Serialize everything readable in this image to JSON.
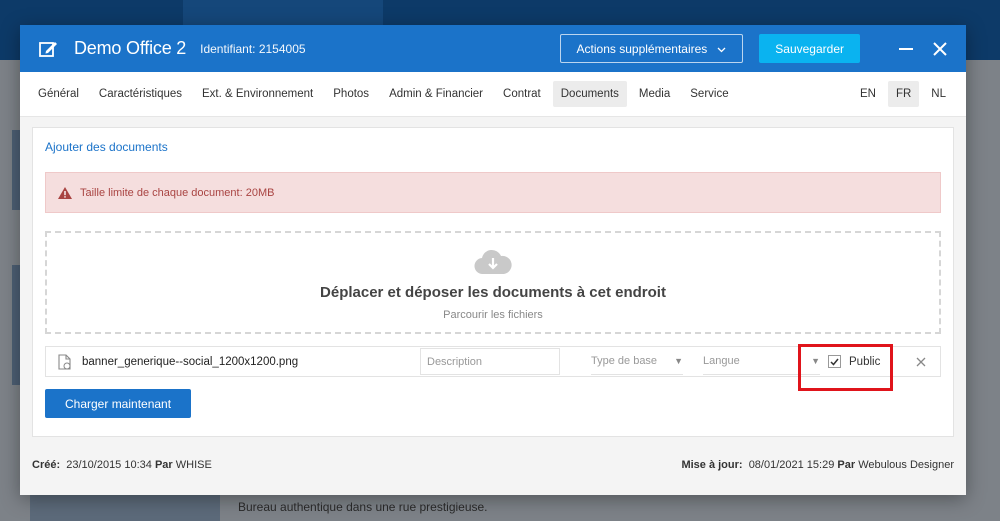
{
  "modal": {
    "title": "Demo Office 2",
    "identifier": "Identifiant: 2154005",
    "actions_label": "Actions supplémentaires",
    "save_label": "Sauvegarder"
  },
  "tabs": [
    {
      "label": "Général"
    },
    {
      "label": "Caractéristiques"
    },
    {
      "label": "Ext. & Environnement"
    },
    {
      "label": "Photos"
    },
    {
      "label": "Admin & Financier"
    },
    {
      "label": "Contrat"
    },
    {
      "label": "Documents",
      "active": true
    },
    {
      "label": "Media"
    },
    {
      "label": "Service"
    }
  ],
  "languages": [
    {
      "label": "EN"
    },
    {
      "label": "FR",
      "active": true
    },
    {
      "label": "NL"
    }
  ],
  "documents": {
    "section_title": "Ajouter des documents",
    "alert_text": "Taille limite de chaque document: 20MB",
    "dropzone_title": "Déplacer et déposer les documents à cet endroit",
    "dropzone_sub": "Parcourir les fichiers",
    "file": {
      "name": "banner_generique--social_1200x1200.png",
      "description_placeholder": "Description",
      "type_placeholder": "Type de base",
      "language_placeholder": "Langue",
      "public_label": "Public",
      "public_checked": true
    },
    "upload_label": "Charger maintenant"
  },
  "footer": {
    "created_label": "Créé:",
    "created_value": "23/10/2015 10:34",
    "by_label": "Par",
    "created_by": "WHISE",
    "updated_label": "Mise à jour:",
    "updated_value": "08/01/2021 15:29",
    "updated_by": "Webulous Designer"
  },
  "background": {
    "description_text": "Bureau authentique dans une rue prestigieuse."
  },
  "colors": {
    "header_blue": "#1b73c9",
    "save_cyan": "#0ab3f0",
    "alert_bg": "#f5dede",
    "highlight_red": "#e0141b"
  }
}
